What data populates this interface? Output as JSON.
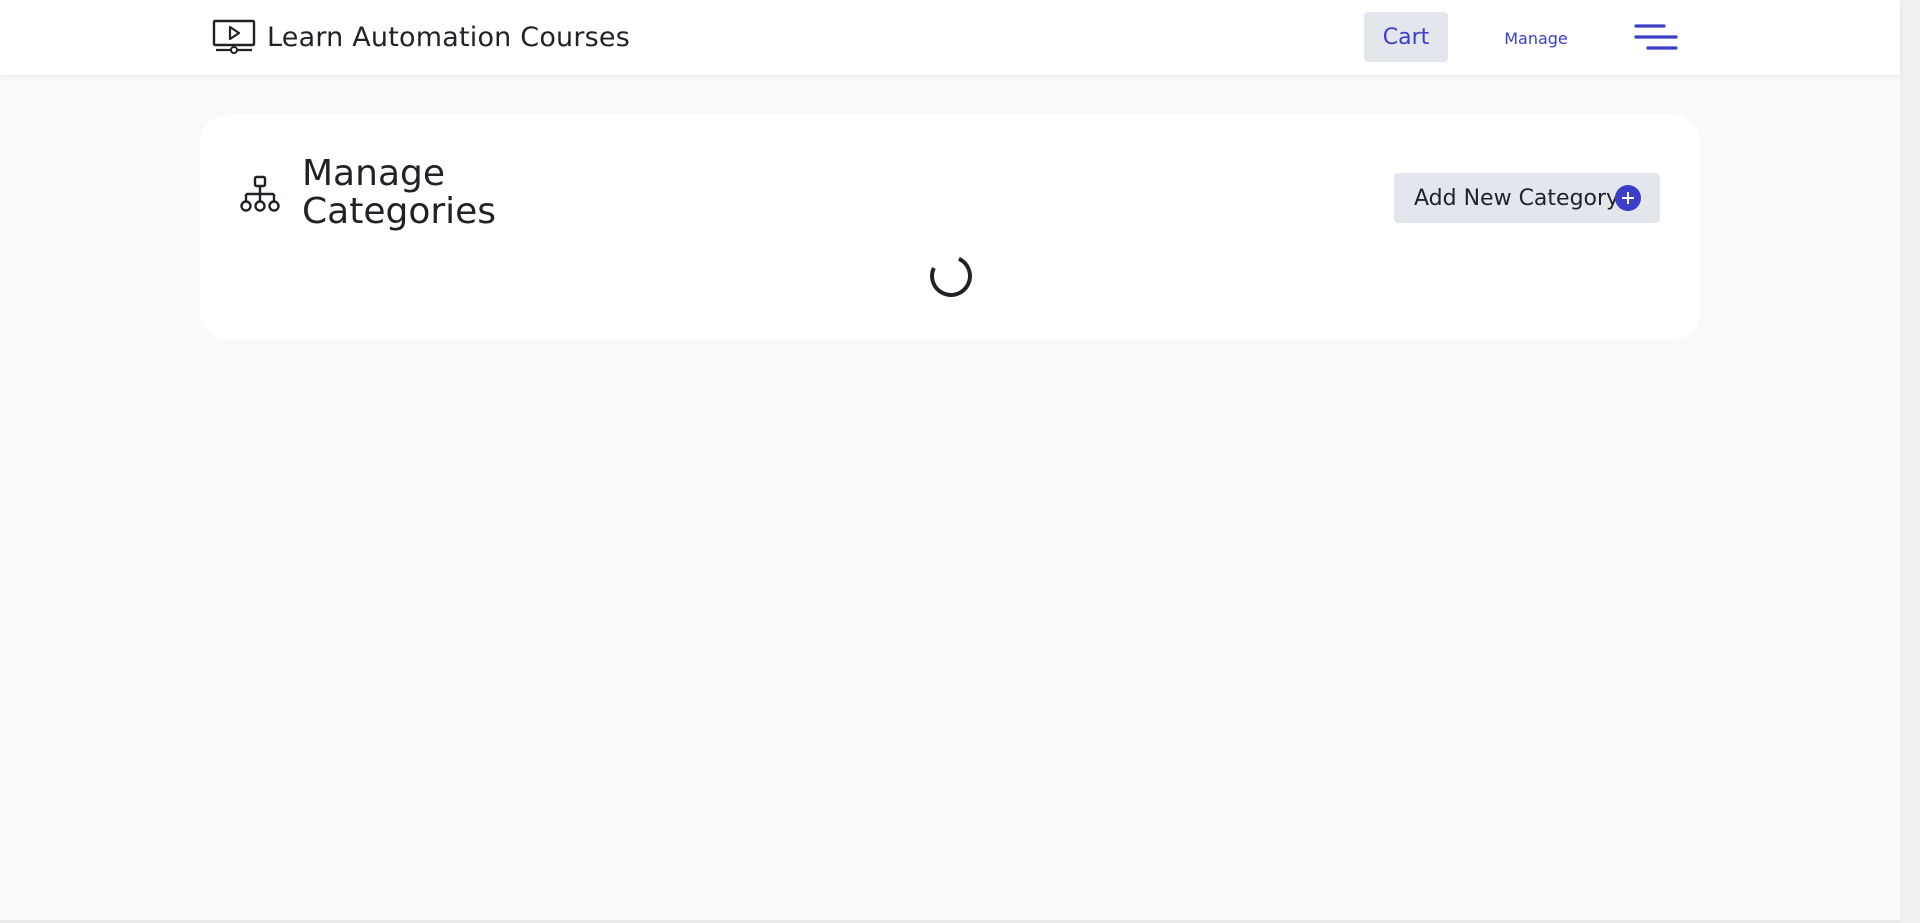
{
  "header": {
    "brand_icon": "video-lesson-icon",
    "brand_title": "Learn Automation Courses",
    "cart_label": "Cart",
    "manage_label": "Manage",
    "menu_icon": "hamburger-menu-icon"
  },
  "main": {
    "page_icon": "category-hierarchy-icon",
    "page_title": "Manage Categories",
    "add_button_label": "Add New Category",
    "add_button_icon": "plus-circle-icon",
    "loading_indicator": "spinner-icon"
  },
  "colors": {
    "accent": "#3a3ec8",
    "button_bg": "#e4e6ee",
    "page_bg": "#f8f9f8",
    "card_bg": "#ffffff",
    "text": "#1f2328"
  }
}
